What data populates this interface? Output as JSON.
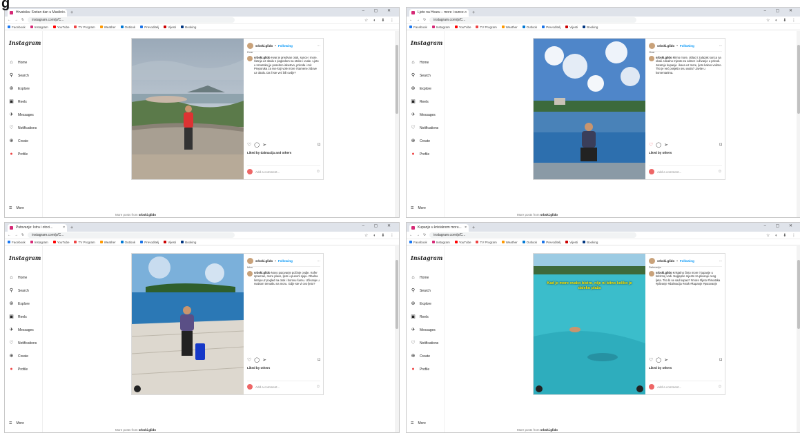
{
  "figure_label": "g",
  "windows": [
    {
      "tab_title": "Hrvatska: Sretan dan u Maslini...",
      "url": "instagram.com/p/C...",
      "profile": "srbski.glido",
      "follow": "Following",
      "location": "Hvar",
      "caption": "Hvar je predivan otok, sunce i more. Šetnja uz obalu s pogledom na otoke i uvale. Ljeto u Hrvatskoj je posebno iskustvo, priroda i mir. Preporuka za sve koji vole more i kamene zidove uz obalu. Da li ste već bili ovdje?",
      "likes": "Liked by dalmacija and others",
      "photo": "hvar"
    },
    {
      "tab_title": "Ljeto na Hvaru – more i sunce...",
      "url": "instagram.com/p/C...",
      "profile": "srbski.glido",
      "follow": "Following",
      "location": "Hvar",
      "caption": "Mirno more, oblaci i zalazak sunca na obali. Idealno mjesto za odmor i uživanje u prirodi. Jutarnje kupanje i kava uz more, ljeto kakvo volimo. Tko je već posjetio ovu uvalu? Javite u komentarima.",
      "likes": "Liked by others",
      "photo": "sea"
    },
    {
      "tab_title": "Putovanje: Istra i otoci...",
      "url": "instagram.com/p/C...",
      "profile": "srbski.glido",
      "follow": "Following",
      "location": "Istra",
      "caption": "Novo putovanje počinje ovdje. Kofer spreman, more plavo, ljeto u punom sjaju. Obalna šetnja uz pogled na otok i borovu šumu. Uživanje u svakom trenutku na moru. Gdje ste vi ovo ljeto?",
      "likes": "Liked by others",
      "photo": "pier"
    },
    {
      "tab_title": "Kupanje u kristalnom moru...",
      "url": "instagram.com/p/C...",
      "profile": "srbski.glido",
      "follow": "Following",
      "location": "Dalmacija",
      "caption": "Kristalno čisto more i kupanje u tirkiznoj vodi. Najljepše mjesto za plivanje ovog ljeta. Tko bi se sad kupao? #more #ljeto #hrvatska #plivanje #dalmacija #otok #kupanje #putovanje",
      "likes": "Liked by others",
      "photo": "swim",
      "overlay_text": "Kad je more ovako bistro, nije ni bitno koliko je daleko plaža"
    }
  ],
  "sidebar": {
    "logo": "Instagram",
    "items": [
      "Home",
      "Search",
      "Explore",
      "Reels",
      "Messages",
      "Notifications",
      "Create",
      "Profile"
    ],
    "more": "More"
  },
  "bookmarks": [
    "Facebook",
    "Instagram",
    "YouTube",
    "TV Program",
    "Weather",
    "Outlook",
    "Prevoditelj",
    "Vijesti",
    "Booking"
  ],
  "add_comment": "Add a comment...",
  "more_posts_prefix": "More posts from",
  "more_posts_user": "srbski.glido"
}
